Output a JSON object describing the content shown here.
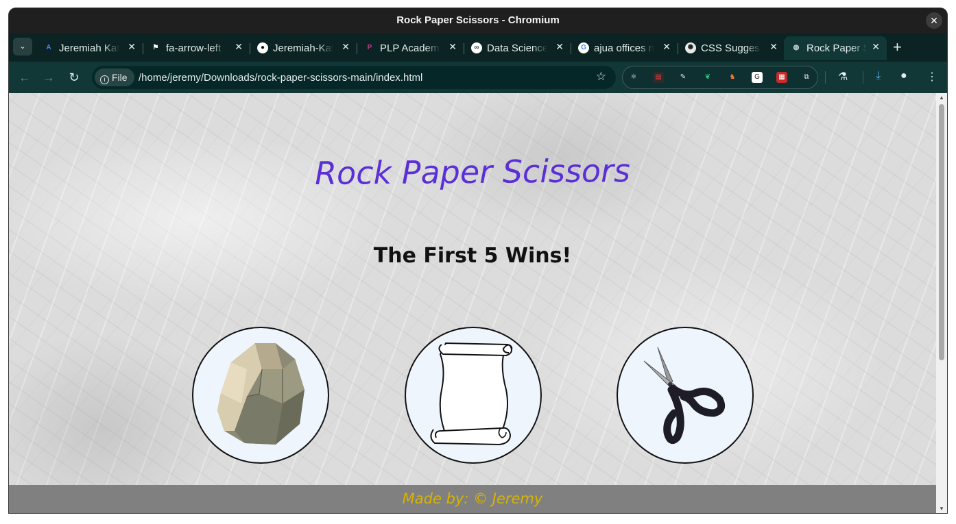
{
  "window": {
    "title": "Rock Paper Scissors - Chromium"
  },
  "tabs": [
    {
      "label": "Jeremiah Katumo",
      "icon": "a-logo-icon"
    },
    {
      "label": "fa-arrow-left",
      "icon": "flag-icon"
    },
    {
      "label": "Jeremiah-Katumo",
      "icon": "github-icon"
    },
    {
      "label": "PLP Academy",
      "icon": "plp-icon"
    },
    {
      "label": "Data Science",
      "icon": "data-science-icon"
    },
    {
      "label": "ajua offices nairobi",
      "icon": "google-icon"
    },
    {
      "label": "CSS Suggestions",
      "icon": "openai-icon"
    },
    {
      "label": "Rock Paper Scissors",
      "icon": "globe-icon",
      "active": true
    }
  ],
  "toolbar": {
    "file_chip": "File",
    "url": "/home/jeremy/Downloads/rock-paper-scissors-main/index.html"
  },
  "page": {
    "title": "Rock Paper Scissors",
    "subtitle": "The First 5 Wins!",
    "choices": [
      "rock",
      "paper",
      "scissors"
    ],
    "footer": "Made by: © Jeremy"
  },
  "colors": {
    "title": "#5b2fd8",
    "footer_text": "#d9b400",
    "footer_bg": "#808080",
    "tabstrip": "#0b2323",
    "toolbar": "#113737"
  }
}
